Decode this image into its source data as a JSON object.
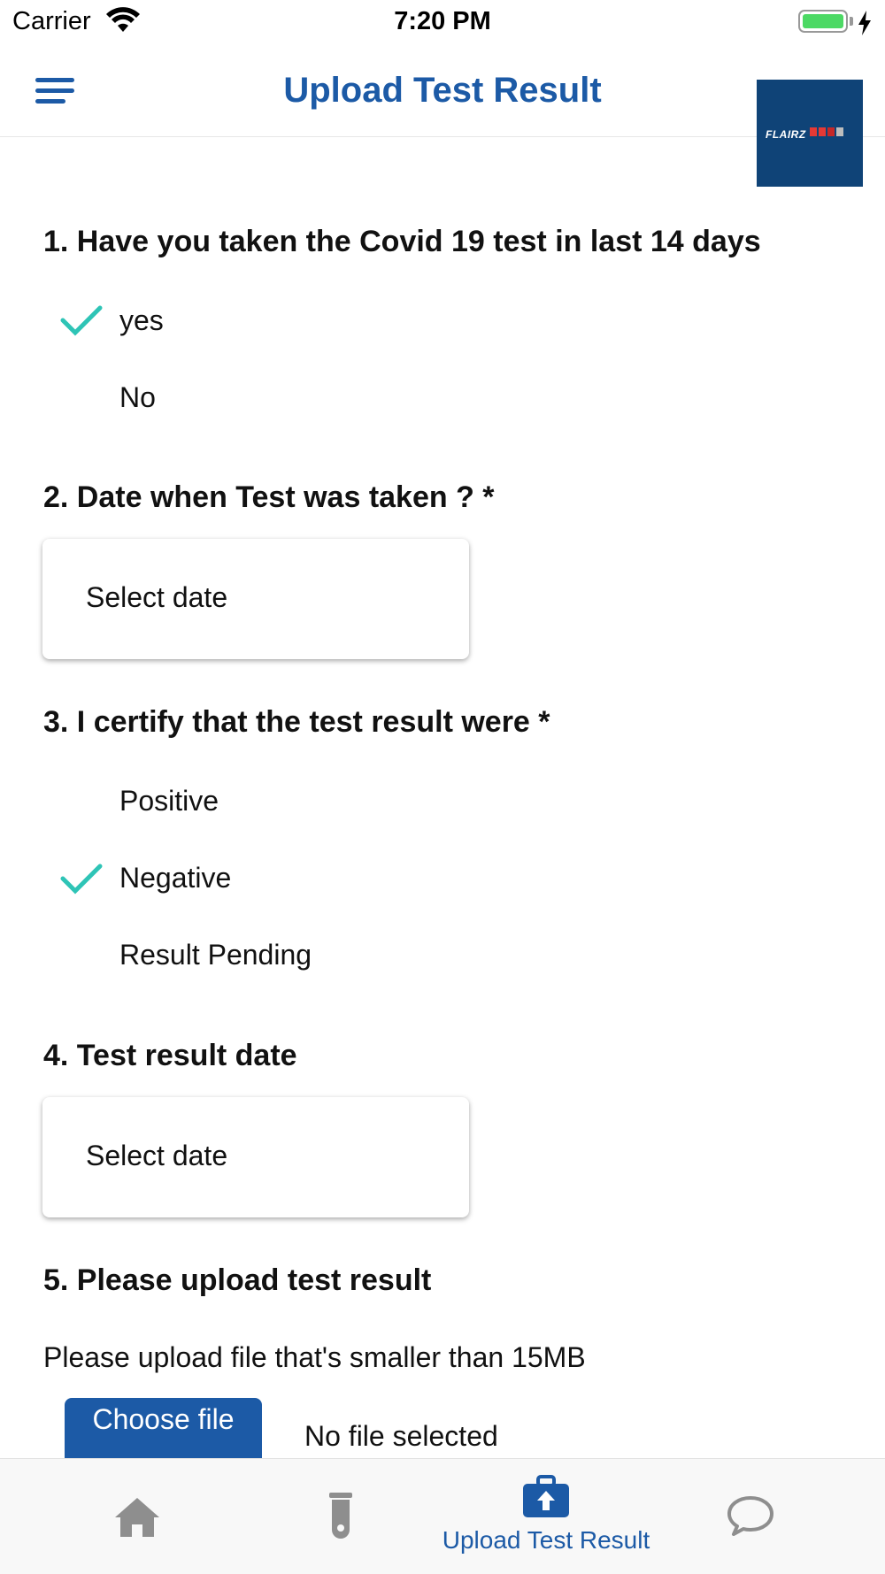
{
  "status_bar": {
    "carrier": "Carrier",
    "time": "7:20 PM",
    "battery_level": 1.0
  },
  "header": {
    "title": "Upload Test Result",
    "logo_text": "FLAIRZ",
    "logo_colors": [
      "#e53935",
      "#e53935",
      "#c62828",
      "#bdbdbd"
    ]
  },
  "form": {
    "q1": {
      "label": "1. Have you taken the Covid 19 test in last 14 days",
      "options": [
        "yes",
        "No"
      ],
      "selected": "yes"
    },
    "q2": {
      "label": "2. Date when Test was taken ? *",
      "placeholder": "Select date"
    },
    "q3": {
      "label": "3. I certify that the test result were *",
      "options": [
        "Positive",
        "Negative",
        "Result Pending"
      ],
      "selected": "Negative"
    },
    "q4": {
      "label": "4. Test result date",
      "placeholder": "Select date"
    },
    "q5": {
      "label": "5. Please upload test result",
      "note": "Please upload file that's smaller than 15MB",
      "button": "Choose file",
      "file_status": "No file selected"
    }
  },
  "tab_bar": {
    "tabs": [
      {
        "icon": "home-icon",
        "label": ""
      },
      {
        "icon": "test-tube-icon",
        "label": ""
      },
      {
        "icon": "upload-icon",
        "label": "Upload Test Result",
        "active": true
      },
      {
        "icon": "chat-bubble-icon",
        "label": ""
      }
    ]
  },
  "colors": {
    "primary": "#1c5aa6",
    "check": "#2ec4b6",
    "inactive_icon": "#8e8e8e"
  }
}
